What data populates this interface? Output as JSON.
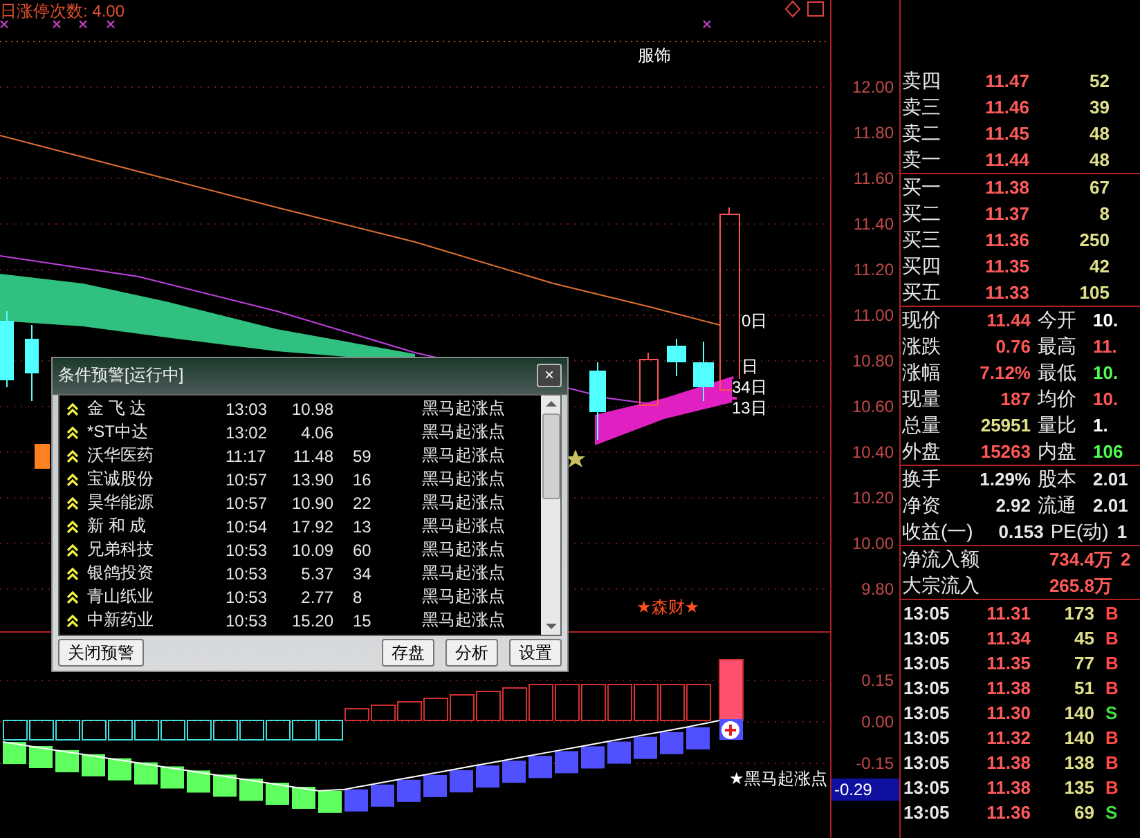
{
  "indicator_title": "日涨停次数: 4.00",
  "sector_label": "服饰",
  "date_labels": [
    "0日",
    "日",
    "34日",
    "13日"
  ],
  "stock_tag": "★森财★",
  "signal_label": "★黑马起涨点",
  "price_axis": [
    "12.00",
    "11.80",
    "11.60",
    "11.40",
    "11.20",
    "11.00",
    "10.80",
    "10.60",
    "10.40",
    "10.20",
    "10.00",
    "9.80"
  ],
  "lower_axis": [
    "0.15",
    "0.00",
    "-0.15"
  ],
  "lower_current": "-0.29",
  "alert_dialog": {
    "title": "条件预警[运行中]",
    "close": "×",
    "rows": [
      {
        "name": "金 飞 达",
        "time": "13:03",
        "price": "10.98",
        "signal": "黑马起涨点"
      },
      {
        "name": "*ST中达",
        "time": "13:02",
        "price": "4.06",
        "signal": "黑马起涨点"
      },
      {
        "name": "沃华医药",
        "time": "11:17",
        "price": "11.48",
        "count": "59",
        "signal": "黑马起涨点"
      },
      {
        "name": "宝诚股份",
        "time": "10:57",
        "price": "13.90",
        "count": "16",
        "signal": "黑马起涨点"
      },
      {
        "name": "昊华能源",
        "time": "10:57",
        "price": "10.90",
        "count": "22",
        "signal": "黑马起涨点"
      },
      {
        "name": "新 和 成",
        "time": "10:54",
        "price": "17.92",
        "count": "13",
        "signal": "黑马起涨点"
      },
      {
        "name": "兄弟科技",
        "time": "10:53",
        "price": "10.09",
        "count": "60",
        "signal": "黑马起涨点"
      },
      {
        "name": "银鸽投资",
        "time": "10:53",
        "price": "5.37",
        "count": "34",
        "signal": "黑马起涨点"
      },
      {
        "name": "青山纸业",
        "time": "10:53",
        "price": "2.77",
        "count": "8",
        "signal": "黑马起涨点"
      },
      {
        "name": "中新药业",
        "time": "10:53",
        "price": "15.20",
        "count": "15",
        "signal": "黑马起涨点"
      }
    ],
    "left_button": "关闭预警",
    "right_buttons": [
      "存盘",
      "分析",
      "设置"
    ]
  },
  "order_book": {
    "sells": [
      {
        "label": "卖四",
        "price": "11.47",
        "volume": "52"
      },
      {
        "label": "卖三",
        "price": "11.46",
        "volume": "39"
      },
      {
        "label": "卖二",
        "price": "11.45",
        "volume": "48"
      },
      {
        "label": "卖一",
        "price": "11.44",
        "volume": "48"
      }
    ],
    "buys": [
      {
        "label": "买一",
        "price": "11.38",
        "volume": "67"
      },
      {
        "label": "买二",
        "price": "11.37",
        "volume": "8"
      },
      {
        "label": "买三",
        "price": "11.36",
        "volume": "250"
      },
      {
        "label": "买四",
        "price": "11.35",
        "volume": "42"
      },
      {
        "label": "买五",
        "price": "11.33",
        "volume": "105"
      }
    ]
  },
  "stats": [
    {
      "left": {
        "label": "现价",
        "value": "11.44",
        "color": "#ff5656"
      },
      "right": {
        "label": "今开",
        "value": "10.",
        "color": "#ffffff"
      }
    },
    {
      "left": {
        "label": "涨跌",
        "value": "0.76",
        "color": "#ff5656"
      },
      "right": {
        "label": "最高",
        "value": "11.",
        "color": "#ff5656"
      }
    },
    {
      "left": {
        "label": "涨幅",
        "value": "7.12%",
        "color": "#ff5656"
      },
      "right": {
        "label": "最低",
        "value": "10.",
        "color": "#50ff50"
      }
    },
    {
      "left": {
        "label": "现量",
        "value": "187",
        "color": "#ff5656"
      },
      "right": {
        "label": "均价",
        "value": "10.",
        "color": "#ff5656"
      }
    },
    {
      "left": {
        "label": "总量",
        "value": "25951",
        "color": "#e0e08a"
      },
      "right": {
        "label": "量比",
        "value": "1.",
        "color": "#ffffff"
      }
    },
    {
      "left": {
        "label": "外盘",
        "value": "15263",
        "color": "#ff5656"
      },
      "right": {
        "label": "内盘",
        "value": "106",
        "color": "#50ff50"
      }
    }
  ],
  "fundamentals": [
    {
      "label": "换手",
      "value": "1.29%",
      "label2": "股本",
      "value2": "2.01"
    },
    {
      "label": "净资",
      "value": "2.92",
      "label2": "流通",
      "value2": "2.01"
    },
    {
      "label": "收益(一)",
      "value": "0.153",
      "label2": "PE(动)",
      "value2": "1"
    }
  ],
  "flows": [
    {
      "label": "净流入额",
      "value": "734.4万",
      "extra": "2"
    },
    {
      "label": "大宗流入",
      "value": "265.8万"
    }
  ],
  "ticks": [
    {
      "time": "13:05",
      "price": "11.31",
      "volume": "173",
      "side": "B",
      "color": "#ff4848"
    },
    {
      "time": "13:05",
      "price": "11.34",
      "volume": "45",
      "side": "B",
      "color": "#ff4848"
    },
    {
      "time": "13:05",
      "price": "11.35",
      "volume": "77",
      "side": "B",
      "color": "#ff4848"
    },
    {
      "time": "13:05",
      "price": "11.38",
      "volume": "51",
      "side": "B",
      "color": "#ff4848"
    },
    {
      "time": "13:05",
      "price": "11.30",
      "volume": "140",
      "side": "S",
      "color": "#40e040"
    },
    {
      "time": "13:05",
      "price": "11.32",
      "volume": "140",
      "side": "B",
      "color": "#ff4848"
    },
    {
      "time": "13:05",
      "price": "11.38",
      "volume": "138",
      "side": "B",
      "color": "#ff4848"
    },
    {
      "time": "13:05",
      "price": "11.38",
      "volume": "135",
      "side": "B",
      "color": "#ff4848"
    },
    {
      "time": "13:05",
      "price": "11.36",
      "volume": "69",
      "side": "S",
      "color": "#40e040"
    }
  ]
}
